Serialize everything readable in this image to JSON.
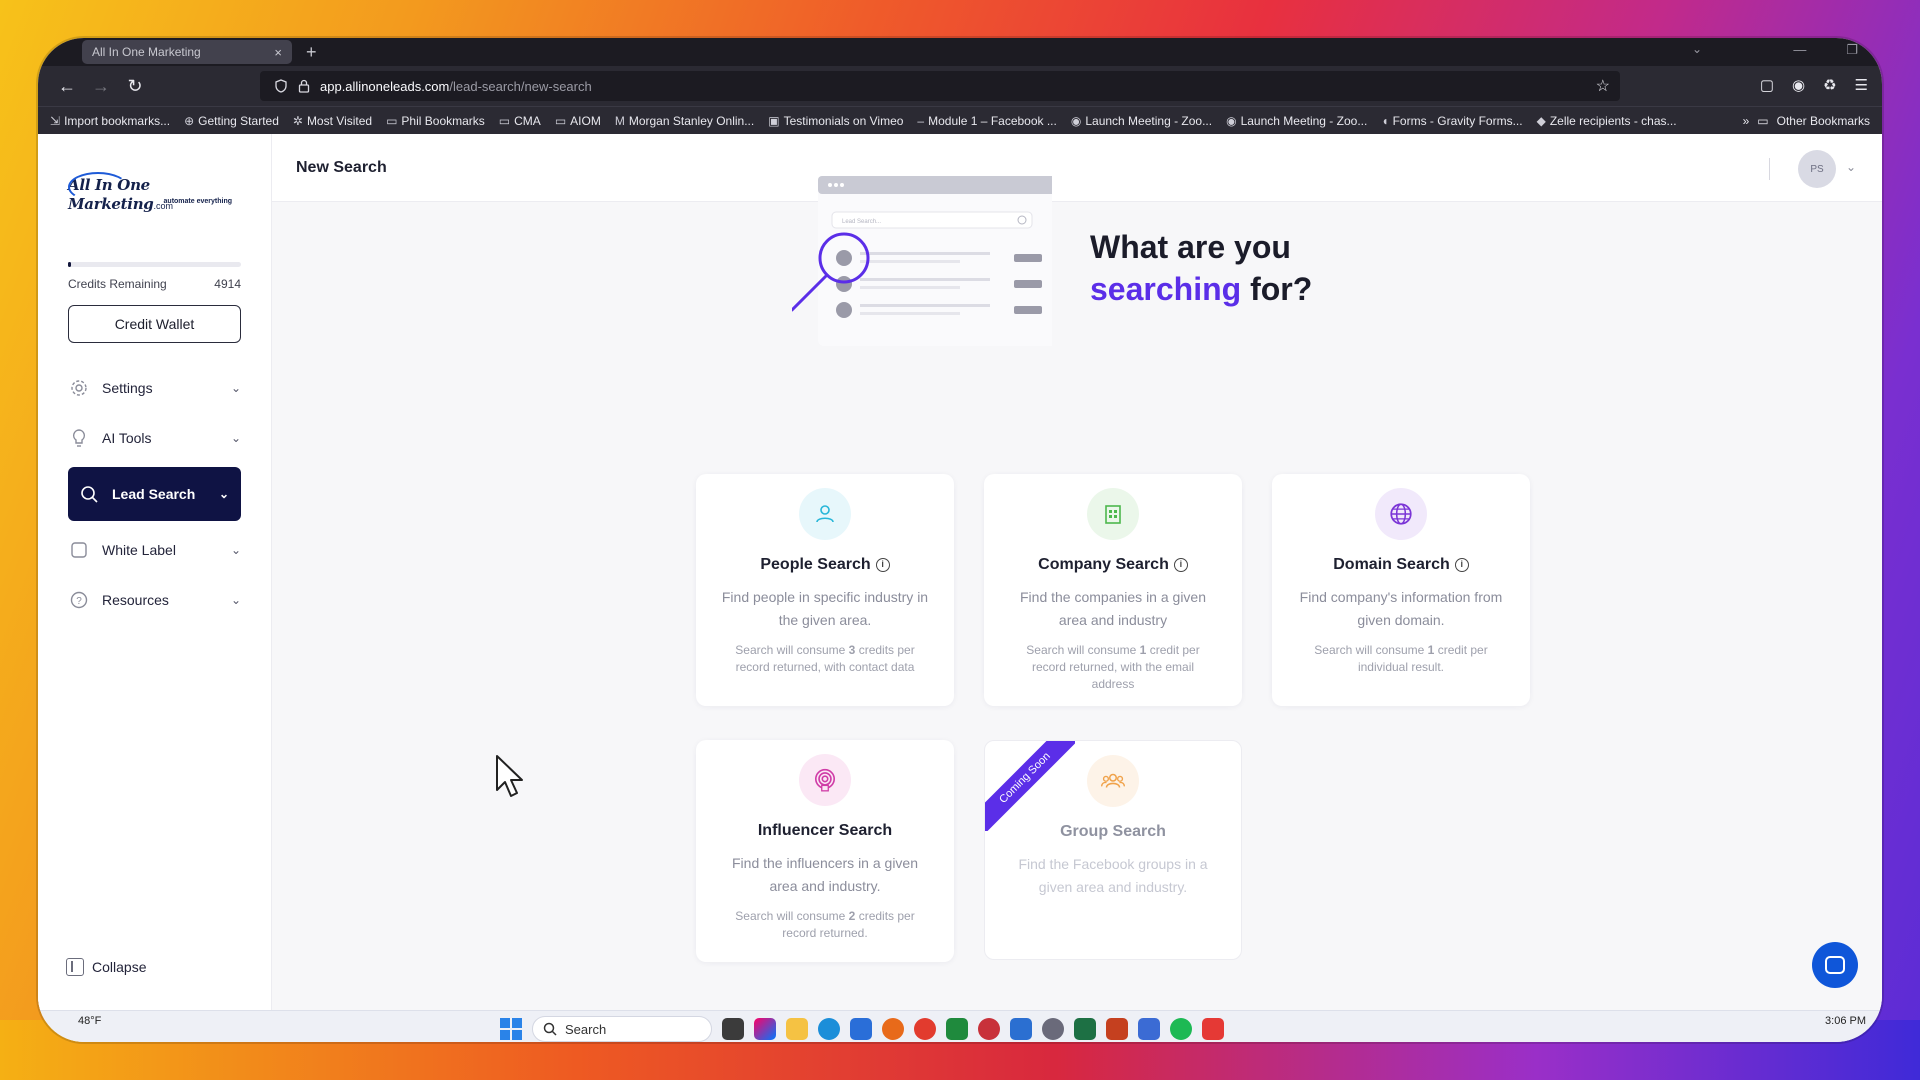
{
  "browser": {
    "tab_title": "All In One Marketing",
    "tab_close": "×",
    "new_tab": "+",
    "url_host": "app.allinoneleads.com",
    "url_path": "/lead-search/new-search",
    "bookmarks": [
      {
        "label": "Import bookmarks...",
        "icon": "import-icon"
      },
      {
        "label": "Getting Started",
        "icon": "globe-icon"
      },
      {
        "label": "Most Visited",
        "icon": "gear-icon"
      },
      {
        "label": "Phil Bookmarks",
        "icon": "folder-icon"
      },
      {
        "label": "CMA",
        "icon": "folder-icon"
      },
      {
        "label": "AIOM",
        "icon": "folder-icon"
      },
      {
        "label": "Morgan Stanley Onlin...",
        "icon": "ms-icon"
      },
      {
        "label": "Testimonials on Vimeo",
        "icon": "vimeo-icon"
      },
      {
        "label": "Module 1 – Facebook ...",
        "icon": "dash-icon"
      },
      {
        "label": "Launch Meeting - Zoo...",
        "icon": "zoom-icon"
      },
      {
        "label": "Launch Meeting - Zoo...",
        "icon": "zoom-icon"
      },
      {
        "label": "Forms - Gravity Forms...",
        "icon": "gravity-icon"
      },
      {
        "label": "Zelle recipients - chas...",
        "icon": "chase-icon"
      }
    ],
    "other_bookmarks": "Other Bookmarks"
  },
  "sidebar": {
    "logo_text": "All In One Marketing",
    "logo_com": ".com",
    "logo_tagline": "automate everything",
    "credits_label": "Credits Remaining",
    "credits_value": "4914",
    "credits_fraction": 0.02,
    "credit_wallet": "Credit Wallet",
    "items": [
      {
        "label": "Settings"
      },
      {
        "label": "AI Tools"
      },
      {
        "label": "Lead Search"
      },
      {
        "label": "White Label"
      },
      {
        "label": "Resources"
      }
    ],
    "collapse": "Collapse"
  },
  "header": {
    "title": "New Search",
    "avatar_initials": "PS"
  },
  "hero": {
    "line1": "What are you",
    "accent": "searching",
    "line2_rest": "for?",
    "mock_search_placeholder": "Lead Search..."
  },
  "cards": [
    {
      "title": "People Search",
      "desc": "Find people in specific industry in the given area.",
      "note_pre": "Search will consume ",
      "note_num": "3",
      "note_post": " credits per record returned, with contact data",
      "icon": "person-icon",
      "color": "#27b6d8",
      "bg": "#e7f7fb"
    },
    {
      "title": "Company Search",
      "desc": "Find the companies in a given area and industry",
      "note_pre": "Search will consume ",
      "note_num": "1",
      "note_post": " credit per record returned, with the email address",
      "icon": "building-icon",
      "color": "#4cb84c",
      "bg": "#ebf7ea"
    },
    {
      "title": "Domain Search",
      "desc": "Find company's information from given domain.",
      "note_pre": "Search will consume ",
      "note_num": "1",
      "note_post": " credit per individual result.",
      "icon": "globe-icon",
      "color": "#7b35d6",
      "bg": "#f1e9fb"
    },
    {
      "title": "Influencer Search",
      "desc": "Find the influencers in a given area and industry.",
      "note_pre": "Search will consume ",
      "note_num": "2",
      "note_post": " credits per record returned.",
      "icon": "broadcast-icon",
      "color": "#d03ca7",
      "bg": "#fbe8f5"
    },
    {
      "title": "Group Search",
      "desc": "Find the Facebook groups in a given area and industry.",
      "ribbon": "Coming Soon",
      "icon": "group-icon",
      "color": "#f0a24a",
      "bg": "#fdf3e8"
    }
  ],
  "taskbar": {
    "temp": "48°F",
    "search": "Search",
    "time": "3:06 PM"
  }
}
